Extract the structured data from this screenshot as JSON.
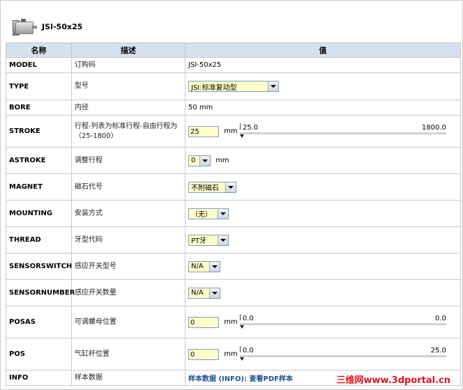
{
  "header": {
    "title": "JSI-50x25"
  },
  "table": {
    "col_name": "名称",
    "col_desc": "描述",
    "col_value": "值",
    "rows": {
      "model": {
        "name": "MODEL",
        "desc": "订购码",
        "value": "JSI-50x25"
      },
      "type": {
        "name": "TYPE",
        "desc": "型号",
        "selected": "JSI:标准复动型"
      },
      "bore": {
        "name": "BORE",
        "desc": "内径",
        "value": "50 mm"
      },
      "stroke": {
        "name": "STROKE",
        "desc": "行程-列表为标准行程-自由行程为（25-1800）",
        "value": "25",
        "unit": "mm",
        "slider_min": "25.0",
        "slider_max": "1800.0",
        "slider_fraction": 0
      },
      "astroke": {
        "name": "ASTROKE",
        "desc": "调整行程",
        "selected": "0",
        "unit": "mm"
      },
      "magnet": {
        "name": "MAGNET",
        "desc": "磁石代号",
        "selected": "不附磁石"
      },
      "mounting": {
        "name": "MOUNTING",
        "desc": "安装方式",
        "selected": "（无）"
      },
      "thread": {
        "name": "THREAD",
        "desc": "牙型代码",
        "selected": "PT牙"
      },
      "sensorswitch": {
        "name": "SENSORSWITCH",
        "desc": "感应开关型号",
        "selected": "N/A"
      },
      "sensornumber": {
        "name": "SENSORNUMBER",
        "desc": "感应开关数量",
        "selected": "N/A"
      },
      "posas": {
        "name": "POSAS",
        "desc": "可调螺母位置",
        "value": "0",
        "unit": "mm",
        "slider_min": "0.0",
        "slider_max": "0.0",
        "slider_fraction": 0
      },
      "pos": {
        "name": "POS",
        "desc": "气缸杆位置",
        "value": "0",
        "unit": "mm",
        "slider_min": "0.0",
        "slider_max": "25.0",
        "slider_fraction": 0
      },
      "info": {
        "name": "INFO",
        "desc": "样本数据",
        "link": "样本数据 (INFO): 查看PDF样本"
      }
    }
  },
  "watermark": "三维网www.3dportal.cn",
  "colors": {
    "header_bg": "#d4e1ef",
    "input_bg": "#ffffcc",
    "link": "#1f4f8f",
    "watermark": "#e0141c"
  }
}
